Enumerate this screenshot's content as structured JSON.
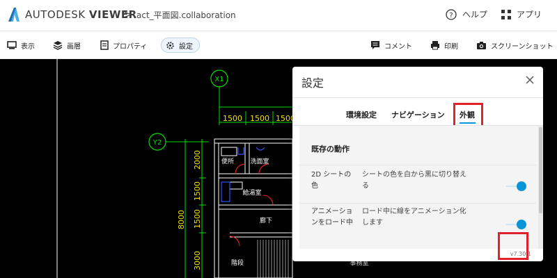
{
  "header": {
    "brand_light": "AUTODESK",
    "brand_bold": "VIEWER",
    "separator": ">",
    "filename": "act_平面図.collaboration",
    "help_label": "ヘルプ",
    "apps_label": "アプリ"
  },
  "toolbar": {
    "view_label": "表示",
    "layers_label": "画層",
    "properties_label": "プロパティ",
    "settings_label": "設定",
    "comment_label": "コメント",
    "print_label": "印刷",
    "screenshot_label": "スクリーンショット"
  },
  "drawing": {
    "axis_x1": "X1",
    "axis_y2": "Y2",
    "dim_top_1": "1500",
    "dim_top_2": "1500",
    "dim_top_3": "1500",
    "dim_left_total": "8000",
    "dim_left_1": "2000",
    "dim_left_2": "1500",
    "dim_left_3": "1500",
    "dim_left_4": "3000",
    "room_toilet": "便所",
    "room_washroom": "洗面室",
    "room_water_heater": "給湯室",
    "room_corridor": "廊下",
    "room_stairs": "階段",
    "room_office": "事務室",
    "line_color": "#f0e000",
    "dim_color": "#00e000",
    "wall_color": "#ffffff"
  },
  "settings_panel": {
    "title": "設定",
    "tabs": [
      "環境設定",
      "ナビゲーション",
      "外観"
    ],
    "active_tab": "外観",
    "section_title": "既存の動作",
    "rows": [
      {
        "name": "2D シートの色",
        "description": "シートの色を白から黒に切り替える",
        "enabled": true
      },
      {
        "name": "アニメーションをロード中",
        "description": "ロード中に線をアニメーション化します",
        "enabled": true
      }
    ],
    "version": "v7.30.1",
    "accent_color": "#0696d7",
    "highlight_color": "#e0202c"
  }
}
